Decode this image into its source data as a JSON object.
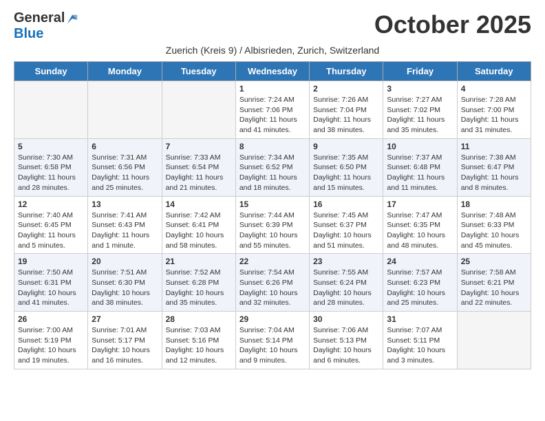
{
  "logo": {
    "general": "General",
    "blue": "Blue"
  },
  "title": "October 2025",
  "subtitle": "Zuerich (Kreis 9) / Albisrieden, Zurich, Switzerland",
  "days_of_week": [
    "Sunday",
    "Monday",
    "Tuesday",
    "Wednesday",
    "Thursday",
    "Friday",
    "Saturday"
  ],
  "weeks": [
    [
      {
        "day": "",
        "info": ""
      },
      {
        "day": "",
        "info": ""
      },
      {
        "day": "",
        "info": ""
      },
      {
        "day": "1",
        "info": "Sunrise: 7:24 AM\nSunset: 7:06 PM\nDaylight: 11 hours and 41 minutes."
      },
      {
        "day": "2",
        "info": "Sunrise: 7:26 AM\nSunset: 7:04 PM\nDaylight: 11 hours and 38 minutes."
      },
      {
        "day": "3",
        "info": "Sunrise: 7:27 AM\nSunset: 7:02 PM\nDaylight: 11 hours and 35 minutes."
      },
      {
        "day": "4",
        "info": "Sunrise: 7:28 AM\nSunset: 7:00 PM\nDaylight: 11 hours and 31 minutes."
      }
    ],
    [
      {
        "day": "5",
        "info": "Sunrise: 7:30 AM\nSunset: 6:58 PM\nDaylight: 11 hours and 28 minutes."
      },
      {
        "day": "6",
        "info": "Sunrise: 7:31 AM\nSunset: 6:56 PM\nDaylight: 11 hours and 25 minutes."
      },
      {
        "day": "7",
        "info": "Sunrise: 7:33 AM\nSunset: 6:54 PM\nDaylight: 11 hours and 21 minutes."
      },
      {
        "day": "8",
        "info": "Sunrise: 7:34 AM\nSunset: 6:52 PM\nDaylight: 11 hours and 18 minutes."
      },
      {
        "day": "9",
        "info": "Sunrise: 7:35 AM\nSunset: 6:50 PM\nDaylight: 11 hours and 15 minutes."
      },
      {
        "day": "10",
        "info": "Sunrise: 7:37 AM\nSunset: 6:48 PM\nDaylight: 11 hours and 11 minutes."
      },
      {
        "day": "11",
        "info": "Sunrise: 7:38 AM\nSunset: 6:47 PM\nDaylight: 11 hours and 8 minutes."
      }
    ],
    [
      {
        "day": "12",
        "info": "Sunrise: 7:40 AM\nSunset: 6:45 PM\nDaylight: 11 hours and 5 minutes."
      },
      {
        "day": "13",
        "info": "Sunrise: 7:41 AM\nSunset: 6:43 PM\nDaylight: 11 hours and 1 minute."
      },
      {
        "day": "14",
        "info": "Sunrise: 7:42 AM\nSunset: 6:41 PM\nDaylight: 10 hours and 58 minutes."
      },
      {
        "day": "15",
        "info": "Sunrise: 7:44 AM\nSunset: 6:39 PM\nDaylight: 10 hours and 55 minutes."
      },
      {
        "day": "16",
        "info": "Sunrise: 7:45 AM\nSunset: 6:37 PM\nDaylight: 10 hours and 51 minutes."
      },
      {
        "day": "17",
        "info": "Sunrise: 7:47 AM\nSunset: 6:35 PM\nDaylight: 10 hours and 48 minutes."
      },
      {
        "day": "18",
        "info": "Sunrise: 7:48 AM\nSunset: 6:33 PM\nDaylight: 10 hours and 45 minutes."
      }
    ],
    [
      {
        "day": "19",
        "info": "Sunrise: 7:50 AM\nSunset: 6:31 PM\nDaylight: 10 hours and 41 minutes."
      },
      {
        "day": "20",
        "info": "Sunrise: 7:51 AM\nSunset: 6:30 PM\nDaylight: 10 hours and 38 minutes."
      },
      {
        "day": "21",
        "info": "Sunrise: 7:52 AM\nSunset: 6:28 PM\nDaylight: 10 hours and 35 minutes."
      },
      {
        "day": "22",
        "info": "Sunrise: 7:54 AM\nSunset: 6:26 PM\nDaylight: 10 hours and 32 minutes."
      },
      {
        "day": "23",
        "info": "Sunrise: 7:55 AM\nSunset: 6:24 PM\nDaylight: 10 hours and 28 minutes."
      },
      {
        "day": "24",
        "info": "Sunrise: 7:57 AM\nSunset: 6:23 PM\nDaylight: 10 hours and 25 minutes."
      },
      {
        "day": "25",
        "info": "Sunrise: 7:58 AM\nSunset: 6:21 PM\nDaylight: 10 hours and 22 minutes."
      }
    ],
    [
      {
        "day": "26",
        "info": "Sunrise: 7:00 AM\nSunset: 5:19 PM\nDaylight: 10 hours and 19 minutes."
      },
      {
        "day": "27",
        "info": "Sunrise: 7:01 AM\nSunset: 5:17 PM\nDaylight: 10 hours and 16 minutes."
      },
      {
        "day": "28",
        "info": "Sunrise: 7:03 AM\nSunset: 5:16 PM\nDaylight: 10 hours and 12 minutes."
      },
      {
        "day": "29",
        "info": "Sunrise: 7:04 AM\nSunset: 5:14 PM\nDaylight: 10 hours and 9 minutes."
      },
      {
        "day": "30",
        "info": "Sunrise: 7:06 AM\nSunset: 5:13 PM\nDaylight: 10 hours and 6 minutes."
      },
      {
        "day": "31",
        "info": "Sunrise: 7:07 AM\nSunset: 5:11 PM\nDaylight: 10 hours and 3 minutes."
      },
      {
        "day": "",
        "info": ""
      }
    ]
  ]
}
